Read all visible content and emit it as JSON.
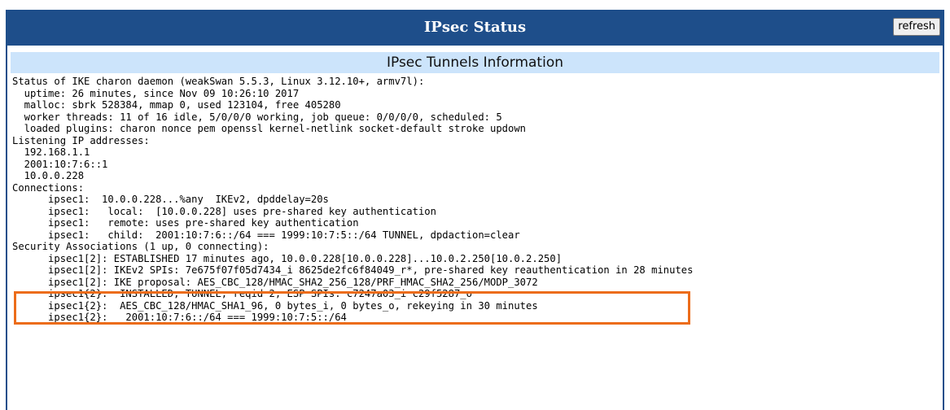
{
  "header": {
    "title": "IPsec Status",
    "refresh_label": "refresh"
  },
  "section": {
    "title": "IPsec Tunnels Information"
  },
  "status_output": {
    "lines": [
      "Status of IKE charon daemon (weakSwan 5.5.3, Linux 3.12.10+, armv7l):",
      "  uptime: 26 minutes, since Nov 09 10:26:10 2017",
      "  malloc: sbrk 528384, mmap 0, used 123104, free 405280",
      "  worker threads: 11 of 16 idle, 5/0/0/0 working, job queue: 0/0/0/0, scheduled: 5",
      "  loaded plugins: charon nonce pem openssl kernel-netlink socket-default stroke updown",
      "Listening IP addresses:",
      "  192.168.1.1",
      "  2001:10:7:6::1",
      "  10.0.0.228",
      "Connections:",
      "      ipsec1:  10.0.0.228...%any  IKEv2, dpddelay=20s",
      "      ipsec1:   local:  [10.0.0.228] uses pre-shared key authentication",
      "      ipsec1:   remote: uses pre-shared key authentication",
      "      ipsec1:   child:  2001:10:7:6::/64 === 1999:10:7:5::/64 TUNNEL, dpdaction=clear",
      "Security Associations (1 up, 0 connecting):",
      "      ipsec1[2]: ESTABLISHED 17 minutes ago, 10.0.0.228[10.0.0.228]...10.0.2.250[10.0.2.250]",
      "      ipsec1[2]: IKEv2 SPIs: 7e675f07f05d7434_i 8625de2fc6f84049_r*, pre-shared key reauthentication in 28 minutes",
      "      ipsec1[2]: IKE proposal: AES_CBC_128/HMAC_SHA2_256_128/PRF_HMAC_SHA2_256/MODP_3072",
      "      ipsec1{2}:  INSTALLED, TUNNEL, reqid 2, ESP SPIs: c7247a03_i c29f5287_o",
      "      ipsec1{2}:  AES_CBC_128/HMAC_SHA1_96, 0 bytes_i, 0 bytes_o, rekeying in 30 minutes",
      "      ipsec1{2}:   2001:10:7:6::/64 === 1999:10:7:5::/64"
    ]
  },
  "highlight": {
    "color": "#ec6c1a",
    "covers_lines": [
      14,
      15
    ]
  },
  "colors": {
    "header_bg": "#1e4e8a",
    "section_bg": "#cce4fb"
  }
}
